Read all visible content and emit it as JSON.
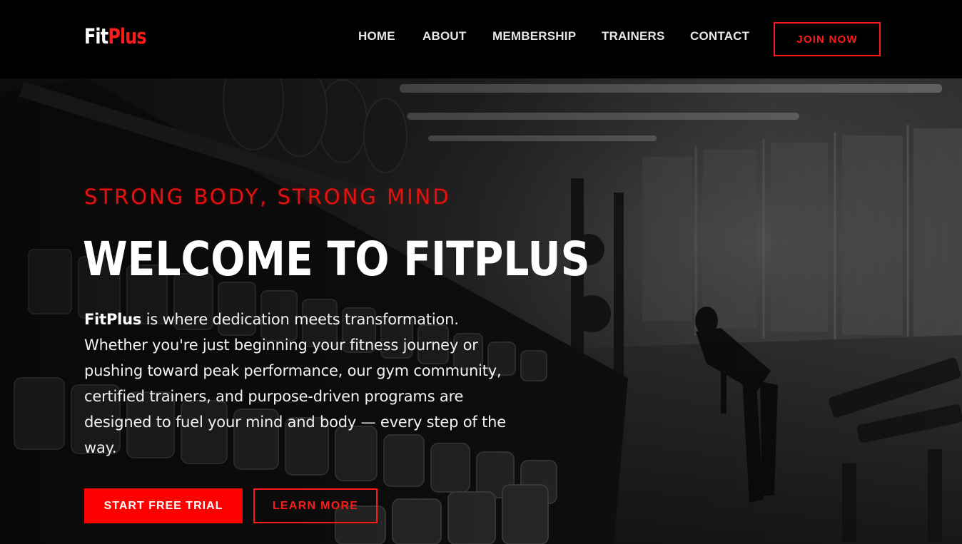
{
  "brand": {
    "logo_part1": "Fit",
    "logo_part2": "Plus"
  },
  "nav": {
    "links": [
      "HOME",
      "ABOUT",
      "MEMBERSHIP",
      "TRAINERS",
      "CONTACT"
    ],
    "cta_label": "JOIN NOW"
  },
  "hero": {
    "tagline": "STRONG BODY, STRONG MIND",
    "headline": "WELCOME TO FITPLUS",
    "description_brand": "FitPlus",
    "description_rest": " is where dedication meets transformation. Whether you're just beginning your fitness journey or pushing toward peak performance, our gym community, certified trainers, and purpose-driven programs are designed to fuel your mind and body — every step of the way.",
    "primary_button": "START FREE TRIAL",
    "secondary_button": "LEARN MORE"
  },
  "colors": {
    "accent": "#ff0000",
    "background": "#000000",
    "text": "#ffffff"
  }
}
